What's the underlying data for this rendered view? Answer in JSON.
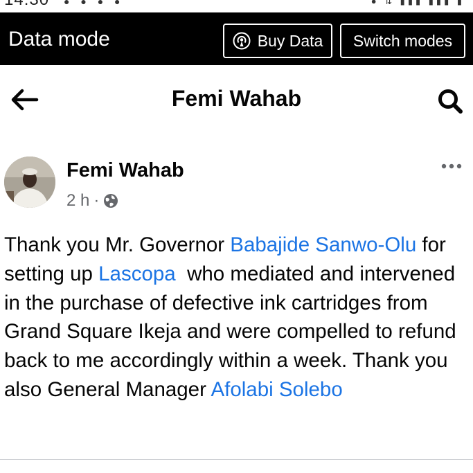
{
  "status_bar": {
    "time": "14:30"
  },
  "data_mode_bar": {
    "title": "Data mode",
    "buy_data_label": "Buy Data",
    "switch_modes_label": "Switch modes"
  },
  "header": {
    "title": "Femi Wahab",
    "back_icon": "back-arrow-icon",
    "search_icon": "search-icon"
  },
  "post": {
    "author": "Femi Wahab",
    "time": "2 h",
    "separator": "·",
    "privacy_icon": "globe-icon",
    "more_icon": "more-options-icon",
    "text_segments": [
      {
        "text": "Thank you Mr. Governor ",
        "link": false
      },
      {
        "text": "Babajide Sanwo-Olu",
        "link": true
      },
      {
        "text": " for setting up ",
        "link": false
      },
      {
        "text": "Lascopa",
        "link": true
      },
      {
        "text": "  who mediated and intervened in the purchase of defective ink cartridges from Grand Square Ikeja and were compelled to refund back to me accordingly within a week. Thank you also General Manager ",
        "link": false
      },
      {
        "text": "Afolabi Solebo",
        "link": true
      }
    ]
  },
  "colors": {
    "link": "#1b74e4",
    "meta_text": "#65676b",
    "data_bar_bg": "#000000"
  }
}
